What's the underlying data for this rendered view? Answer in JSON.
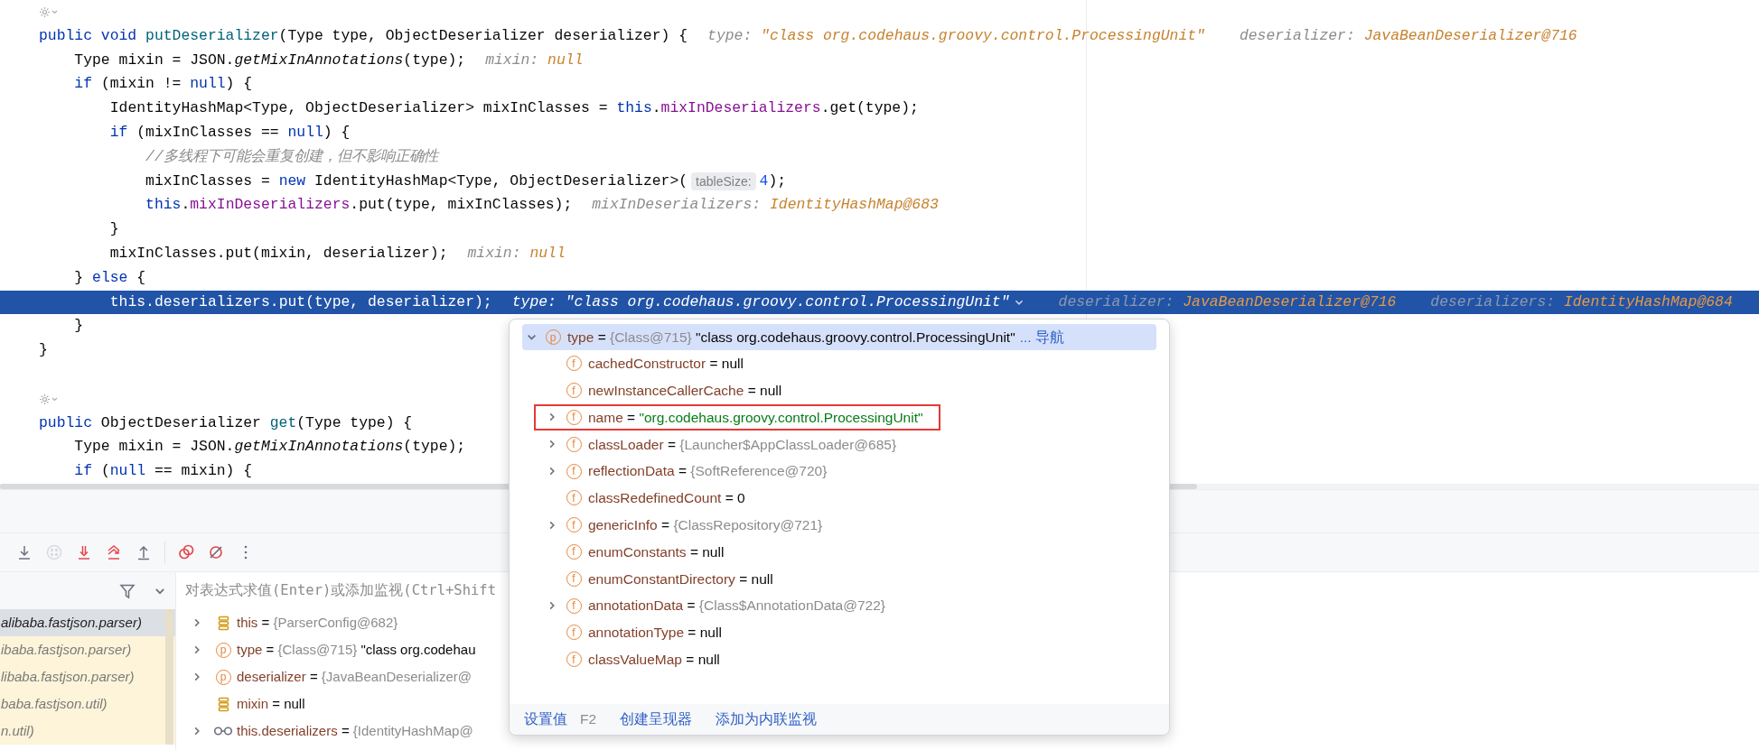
{
  "editor": {
    "lines": [
      {
        "kind": "marker"
      },
      {
        "kind": "code",
        "current": false,
        "segments": [
          {
            "kind": "code",
            "tokens": [
              {
                "kind": "keyword",
                "text": "public void "
              },
              {
                "kind": "method",
                "text": "putDeserializer"
              },
              {
                "kind": "plain",
                "text": "(Type type, ObjectDeserializer deserializer) {"
              }
            ]
          },
          {
            "kind": "value_hint",
            "name": "type:",
            "value": "\"class org.codehaus.groovy.control.ProcessingUnit\"",
            "expanded": false
          },
          {
            "kind": "value_hint",
            "name": "deserializer:",
            "value": "JavaBeanDeserializer@716",
            "expanded": false
          }
        ],
        "children": [
          {
            "kind": "code",
            "current": false,
            "segments": [
              {
                "kind": "code",
                "tokens": [
                  {
                    "kind": "plain",
                    "text": "Type mixin = JSON."
                  },
                  {
                    "kind": "static_call",
                    "text": "getMixInAnnotations"
                  },
                  {
                    "kind": "plain",
                    "text": "(type);"
                  }
                ]
              },
              {
                "kind": "value_hint",
                "name": "mixin:",
                "value": "null",
                "expanded": false
              }
            ]
          },
          {
            "kind": "code",
            "current": false,
            "segments": [
              {
                "kind": "code",
                "tokens": [
                  {
                    "kind": "keyword",
                    "text": "if"
                  },
                  {
                    "kind": "plain",
                    "text": " (mixin != "
                  },
                  {
                    "kind": "keyword",
                    "text": "null"
                  },
                  {
                    "kind": "plain",
                    "text": ") {"
                  }
                ]
              }
            ],
            "children": [
              {
                "kind": "code",
                "current": false,
                "segments": [
                  {
                    "kind": "code",
                    "tokens": [
                      {
                        "kind": "plain",
                        "text": "IdentityHashMap<Type, ObjectDeserializer> mixInClasses = "
                      },
                      {
                        "kind": "keyword",
                        "text": "this"
                      },
                      {
                        "kind": "plain",
                        "text": "."
                      },
                      {
                        "kind": "field",
                        "text": "mixInDeserializers"
                      },
                      {
                        "kind": "plain",
                        "text": ".get(type);"
                      }
                    ]
                  }
                ]
              },
              {
                "kind": "code",
                "current": false,
                "segments": [
                  {
                    "kind": "code",
                    "tokens": [
                      {
                        "kind": "keyword",
                        "text": "if"
                      },
                      {
                        "kind": "plain",
                        "text": " (mixInClasses == "
                      },
                      {
                        "kind": "keyword",
                        "text": "null"
                      },
                      {
                        "kind": "plain",
                        "text": ") {"
                      }
                    ]
                  }
                ],
                "children": [
                  {
                    "kind": "code",
                    "current": false,
                    "segments": [
                      {
                        "kind": "code",
                        "tokens": [
                          {
                            "kind": "comment",
                            "text": "//多线程下可能会重复创建，但不影响正确性"
                          }
                        ]
                      }
                    ]
                  },
                  {
                    "kind": "code",
                    "current": false,
                    "segments": [
                      {
                        "kind": "code",
                        "tokens": [
                          {
                            "kind": "plain",
                            "text": "mixInClasses = "
                          },
                          {
                            "kind": "keyword",
                            "text": "new"
                          },
                          {
                            "kind": "plain",
                            "text": " IdentityHashMap<Type, ObjectDeserializer>("
                          }
                        ]
                      },
                      {
                        "kind": "param_hint",
                        "text": "tableSize:"
                      },
                      {
                        "kind": "code",
                        "tokens": [
                          {
                            "kind": "number",
                            "text": "4"
                          },
                          {
                            "kind": "plain",
                            "text": ");"
                          }
                        ]
                      }
                    ]
                  },
                  {
                    "kind": "code",
                    "current": false,
                    "segments": [
                      {
                        "kind": "code",
                        "tokens": [
                          {
                            "kind": "keyword",
                            "text": "this"
                          },
                          {
                            "kind": "plain",
                            "text": "."
                          },
                          {
                            "kind": "field",
                            "text": "mixInDeserializers"
                          },
                          {
                            "kind": "plain",
                            "text": ".put(type, mixInClasses);"
                          }
                        ]
                      },
                      {
                        "kind": "value_hint",
                        "name": "mixInDeserializers:",
                        "value": "IdentityHashMap@683",
                        "expanded": false
                      }
                    ]
                  }
                ]
              },
              {
                "kind": "code",
                "current": false,
                "segments": [
                  {
                    "kind": "code",
                    "tokens": [
                      {
                        "kind": "plain",
                        "text": "}"
                      }
                    ]
                  }
                ]
              },
              {
                "kind": "code",
                "current": false,
                "segments": [
                  {
                    "kind": "code",
                    "tokens": [
                      {
                        "kind": "plain",
                        "text": "mixInClasses.put(mixin, deserializer);"
                      }
                    ]
                  },
                  {
                    "kind": "value_hint",
                    "name": "mixin:",
                    "value": "null",
                    "expanded": false
                  }
                ]
              }
            ]
          },
          {
            "kind": "code",
            "current": false,
            "segments": [
              {
                "kind": "code",
                "tokens": [
                  {
                    "kind": "plain",
                    "text": "} "
                  },
                  {
                    "kind": "keyword",
                    "text": "else"
                  },
                  {
                    "kind": "plain",
                    "text": " {"
                  }
                ]
              }
            ],
            "children": [
              {
                "kind": "code",
                "current": true,
                "segments": [
                  {
                    "kind": "code",
                    "tokens": [
                      {
                        "kind": "keyword",
                        "text": "this"
                      },
                      {
                        "kind": "plain",
                        "text": "."
                      },
                      {
                        "kind": "field",
                        "text": "deserializers"
                      },
                      {
                        "kind": "plain",
                        "text": ".put(type, deserializer);"
                      }
                    ]
                  },
                  {
                    "kind": "value_hint",
                    "name": "type:",
                    "value": "\"class org.codehaus.groovy.control.ProcessingUnit\"",
                    "expanded": true
                  },
                  {
                    "kind": "value_hint",
                    "name": "deserializer:",
                    "value": "JavaBeanDeserializer@716",
                    "expanded": false
                  },
                  {
                    "kind": "value_hint",
                    "name": "deserializers:",
                    "value": "IdentityHashMap@684",
                    "expanded": false
                  }
                ]
              }
            ]
          },
          {
            "kind": "code",
            "current": false,
            "segments": [
              {
                "kind": "code",
                "tokens": [
                  {
                    "kind": "plain",
                    "text": "}"
                  }
                ]
              }
            ]
          }
        ]
      },
      {
        "kind": "code",
        "current": false,
        "segments": [
          {
            "kind": "code",
            "tokens": [
              {
                "kind": "plain",
                "text": "}"
              }
            ]
          }
        ]
      },
      {
        "kind": "blank"
      },
      {
        "kind": "marker"
      },
      {
        "kind": "code",
        "current": false,
        "segments": [
          {
            "kind": "code",
            "tokens": [
              {
                "kind": "keyword",
                "text": "public"
              },
              {
                "kind": "plain",
                "text": " ObjectDeserializer "
              },
              {
                "kind": "method",
                "text": "get"
              },
              {
                "kind": "plain",
                "text": "(Type type) {"
              }
            ]
          }
        ],
        "children": [
          {
            "kind": "code",
            "current": false,
            "segments": [
              {
                "kind": "code",
                "tokens": [
                  {
                    "kind": "plain",
                    "text": "Type mixin = JSON."
                  },
                  {
                    "kind": "static_call",
                    "text": "getMixInAnnotations"
                  },
                  {
                    "kind": "plain",
                    "text": "(type);"
                  }
                ]
              }
            ]
          },
          {
            "kind": "code",
            "current": false,
            "segments": [
              {
                "kind": "code",
                "tokens": [
                  {
                    "kind": "keyword",
                    "text": "if"
                  },
                  {
                    "kind": "plain",
                    "text": " ("
                  },
                  {
                    "kind": "keyword",
                    "text": "null"
                  },
                  {
                    "kind": "plain",
                    "text": " == mixin) {"
                  }
                ]
              }
            ]
          }
        ]
      }
    ]
  },
  "toolbar": [
    {
      "kind": "step_into",
      "disabled": false
    },
    {
      "kind": "force_step",
      "disabled": true
    },
    {
      "kind": "force_step_into",
      "disabled": false
    },
    {
      "kind": "smart_step_into",
      "disabled": false
    },
    {
      "kind": "step_out",
      "disabled": false
    },
    {
      "kind": "separator"
    },
    {
      "kind": "view_breakpoints",
      "disabled": false
    },
    {
      "kind": "mute_breakpoints",
      "disabled": false
    },
    {
      "kind": "more",
      "disabled": false
    }
  ],
  "frames": [
    {
      "text": "alibaba.fastjson.parser)",
      "selected": true,
      "library": false
    },
    {
      "text": "ibaba.fastjson.parser)",
      "selected": false,
      "library": true
    },
    {
      "text": "libaba.fastjson.parser)",
      "selected": false,
      "library": true
    },
    {
      "text": "baba.fastjson.util)",
      "selected": false,
      "library": true
    },
    {
      "text": "n.util)",
      "selected": false,
      "library": true
    }
  ],
  "evaluate_field": {
    "placeholder": "对表达式求值(Enter)或添加监视(Ctrl+Shift"
  },
  "variables": [
    {
      "kind": "local",
      "name": "this",
      "op": "=",
      "expandable": true,
      "value": [
        {
          "kind": "ref",
          "text": "{ParserConfig@682}"
        }
      ]
    },
    {
      "kind": "parameter",
      "badge": "p",
      "name": "type",
      "op": "=",
      "expandable": true,
      "value": [
        {
          "kind": "ref",
          "text": "{Class@715}"
        },
        {
          "kind": "literal",
          "text": "\"class org.codehau"
        }
      ]
    },
    {
      "kind": "parameter",
      "badge": "p",
      "name": "deserializer",
      "op": "=",
      "expandable": true,
      "value": [
        {
          "kind": "ref",
          "text": "{JavaBeanDeserializer@"
        }
      ]
    },
    {
      "kind": "local",
      "name": "mixin",
      "op": "=",
      "expandable": false,
      "value": [
        {
          "kind": "literal",
          "text": "null"
        }
      ]
    },
    {
      "kind": "watch",
      "name": "this.deserializers",
      "op": "=",
      "expandable": true,
      "value": [
        {
          "kind": "ref",
          "text": "{IdentityHashMap@"
        }
      ]
    }
  ],
  "popup": {
    "root": {
      "badge": "p",
      "name": "type",
      "op": "=",
      "expanded": true,
      "selected": true,
      "value": [
        {
          "kind": "ref",
          "text": "{Class@715}"
        },
        {
          "kind": "literal",
          "text": "\"class org.codehaus.groovy.control.ProcessingUnit\""
        }
      ],
      "link": "... 导航"
    },
    "children": [
      {
        "badge": "f",
        "name": "cachedConstructor",
        "op": "=",
        "expandable": false,
        "highlighted": false,
        "value": [
          {
            "kind": "literal",
            "text": "null"
          }
        ]
      },
      {
        "badge": "f",
        "name": "newInstanceCallerCache",
        "op": "=",
        "expandable": false,
        "highlighted": false,
        "value": [
          {
            "kind": "literal",
            "text": "null"
          }
        ]
      },
      {
        "badge": "f",
        "name": "name",
        "op": "=",
        "expandable": true,
        "highlighted": true,
        "value": [
          {
            "kind": "string",
            "text": "\"org.codehaus.groovy.control.ProcessingUnit\""
          }
        ]
      },
      {
        "badge": "f",
        "name": "classLoader",
        "op": "=",
        "expandable": true,
        "highlighted": false,
        "value": [
          {
            "kind": "ref",
            "text": "{Launcher$AppClassLoader@685}"
          }
        ]
      },
      {
        "badge": "f",
        "name": "reflectionData",
        "op": "=",
        "expandable": true,
        "highlighted": false,
        "value": [
          {
            "kind": "ref",
            "text": "{SoftReference@720}"
          }
        ]
      },
      {
        "badge": "f",
        "name": "classRedefinedCount",
        "op": "=",
        "expandable": false,
        "highlighted": false,
        "value": [
          {
            "kind": "literal",
            "text": "0"
          }
        ]
      },
      {
        "badge": "f",
        "name": "genericInfo",
        "op": "=",
        "expandable": true,
        "highlighted": false,
        "value": [
          {
            "kind": "ref",
            "text": "{ClassRepository@721}"
          }
        ]
      },
      {
        "badge": "f",
        "name": "enumConstants",
        "op": "=",
        "expandable": false,
        "highlighted": false,
        "value": [
          {
            "kind": "literal",
            "text": "null"
          }
        ]
      },
      {
        "badge": "f",
        "name": "enumConstantDirectory",
        "op": "=",
        "expandable": false,
        "highlighted": false,
        "value": [
          {
            "kind": "literal",
            "text": "null"
          }
        ]
      },
      {
        "badge": "f",
        "name": "annotationData",
        "op": "=",
        "expandable": true,
        "highlighted": false,
        "value": [
          {
            "kind": "ref",
            "text": "{Class$AnnotationData@722}"
          }
        ]
      },
      {
        "badge": "f",
        "name": "annotationType",
        "op": "=",
        "expandable": false,
        "highlighted": false,
        "value": [
          {
            "kind": "literal",
            "text": "null"
          }
        ]
      },
      {
        "badge": "f",
        "name": "classValueMap",
        "op": "=",
        "expandable": false,
        "highlighted": false,
        "value": [
          {
            "kind": "literal",
            "text": "null"
          }
        ]
      }
    ],
    "actions": [
      {
        "kind": "link",
        "text": "设置值"
      },
      {
        "kind": "shortcut",
        "text": "F2"
      },
      {
        "kind": "link",
        "text": "创建呈现器"
      },
      {
        "kind": "link",
        "text": "添加为内联监视"
      }
    ]
  }
}
